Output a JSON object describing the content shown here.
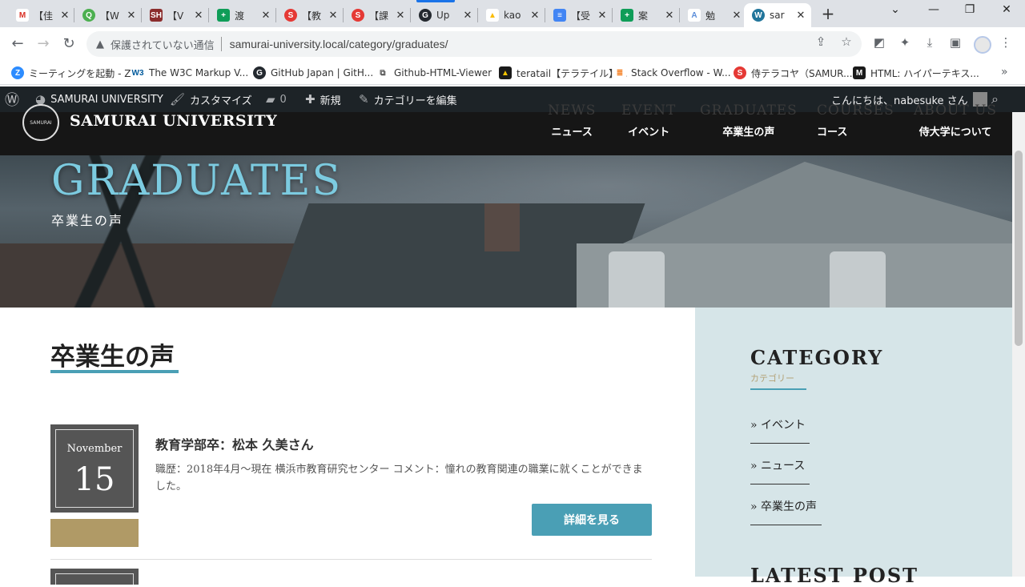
{
  "tabs": [
    {
      "fav": "M",
      "color": "#d93025",
      "title": "【佳"
    },
    {
      "fav": "Q",
      "color": "#4caf50",
      "title": "【W"
    },
    {
      "fav": "SH",
      "color": "#8b2d2d",
      "title": "【V"
    },
    {
      "fav": "+",
      "color": "#0f9d58",
      "title": "渡"
    },
    {
      "fav": "S",
      "color": "#e53935",
      "title": "【教"
    },
    {
      "fav": "S",
      "color": "#e53935",
      "title": "【課"
    },
    {
      "fav": "G",
      "color": "#24292f",
      "title": "Up"
    },
    {
      "fav": "▲",
      "color": "#fbbc04",
      "title": "kao"
    },
    {
      "fav": "≡",
      "color": "#4285f4",
      "title": "【受"
    },
    {
      "fav": "+",
      "color": "#0f9d58",
      "title": "案"
    },
    {
      "fav": "A",
      "color": "#5b8dd9",
      "title": "勉"
    },
    {
      "fav": "W",
      "color": "#21759b",
      "title": "sar"
    }
  ],
  "window": {
    "newtab": "+",
    "dropdown": "⌄",
    "minimize": "—",
    "restore": "❐",
    "close": "✕"
  },
  "omnibox": {
    "security_text": "保護されていない通信",
    "url": "samurai-university.local/category/graduates/"
  },
  "bookmarks": [
    {
      "icon": "Z",
      "color": "#2d8cff",
      "label": "ミーティングを起動 - Z..."
    },
    {
      "icon": "W3",
      "color": "#005a9c",
      "label": "The W3C Markup V..."
    },
    {
      "icon": "G",
      "color": "#24292f",
      "label": "GitHub Japan | GitH..."
    },
    {
      "icon": "⧉",
      "color": "#666666",
      "label": "Github-HTML-Viewer"
    },
    {
      "icon": "▲",
      "color": "#1a1a1a",
      "label": "teratail【テラテイル】..."
    },
    {
      "icon": "≣",
      "color": "#f48024",
      "label": "Stack Overflow - W..."
    },
    {
      "icon": "S",
      "color": "#e53935",
      "label": "侍テラコヤ（SAMUR..."
    },
    {
      "icon": "M",
      "color": "#1a1a1a",
      "label": "HTML: ハイパーテキス..."
    }
  ],
  "adminbar": {
    "site_name": "SAMURAI UNIVERSITY",
    "customize": "カスタマイズ",
    "comments_count": "0",
    "new": "新規",
    "edit_category": "カテゴリーを編集",
    "greeting": "こんにちは、nabesuke さん"
  },
  "site": {
    "title": "SAMURAI UNIVERSITY",
    "logo_text": "SAMURAI",
    "nav": [
      {
        "en": "NEWS",
        "jp": "ニュース"
      },
      {
        "en": "EVENT",
        "jp": "イベント"
      },
      {
        "en": "GRADUATES",
        "jp": "卒業生の声"
      },
      {
        "en": "COURSES",
        "jp": "コース"
      },
      {
        "en": "ABOUT US",
        "jp": "侍大学について"
      }
    ]
  },
  "hero": {
    "title": "GRADUATES",
    "subtitle": "卒業生の声"
  },
  "main": {
    "page_title": "卒業生の声",
    "posts": [
      {
        "month": "November",
        "day": "15",
        "title": "教育学部卒：松本 久美さん",
        "excerpt": "職歴：2018年4月～現在 横浜市教育研究センター コメント：憧れの教育関連の職業に就くことができました。",
        "more": "詳細を見る"
      }
    ]
  },
  "sidebar": {
    "heading": "CATEGORY",
    "sub": "カテゴリー",
    "items": [
      "» イベント",
      "» ニュース",
      "» 卒業生の声"
    ],
    "heading2": "LATEST POST"
  }
}
